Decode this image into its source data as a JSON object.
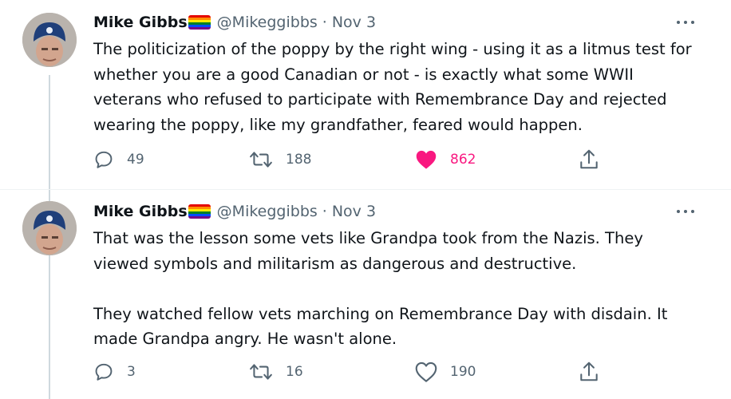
{
  "tweets": [
    {
      "name": "Mike Gibbs",
      "handle": "@Mikeggibbs",
      "separator": "·",
      "date": "Nov 3",
      "text": "The politicization of the poppy by the right wing - using it as a litmus test for whether you are a good Canadian or not - is exactly what some WWII veterans who refused to participate with Remembrance Day and rejected wearing the poppy, like my grandfather, feared would happen.",
      "replies": "49",
      "retweets": "188",
      "likes": "862",
      "liked": true
    },
    {
      "name": "Mike Gibbs",
      "handle": "@Mikeggibbs",
      "separator": "·",
      "date": "Nov 3",
      "text": "That was the lesson some vets like Grandpa took from the Nazis. They viewed symbols and militarism as dangerous and destructive.\n\nThey watched fellow vets marching on Remembrance Day with disdain. It made Grandpa angry. He wasn't alone.",
      "replies": "3",
      "retweets": "16",
      "likes": "190",
      "liked": false
    }
  ],
  "icons": {
    "reply": "reply-icon",
    "retweet": "retweet-icon",
    "like": "heart-icon",
    "share": "share-icon",
    "more": "more-options-icon",
    "flag": "rainbow-flag-emoji"
  },
  "colors": {
    "text": "#0f1419",
    "secondary": "#536471",
    "like_active": "#f91880",
    "thread_line": "#cfd9de"
  }
}
